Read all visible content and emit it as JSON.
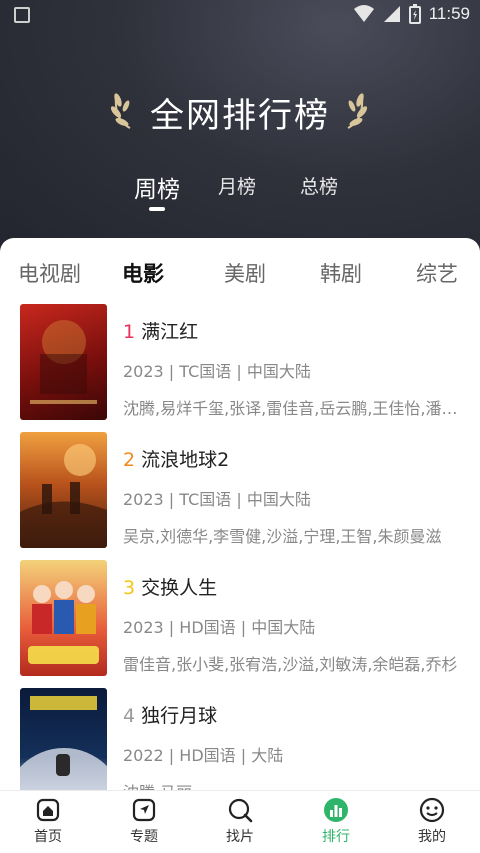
{
  "status_bar": {
    "time": "11:59"
  },
  "hero": {
    "title": "全网排行榜"
  },
  "rank_tabs": [
    {
      "label": "周榜",
      "active": true
    },
    {
      "label": "月榜",
      "active": false
    },
    {
      "label": "总榜",
      "active": false
    }
  ],
  "category_tabs": [
    {
      "label": "电视剧",
      "active": false
    },
    {
      "label": "电影",
      "active": true
    },
    {
      "label": "美剧",
      "active": false
    },
    {
      "label": "韩剧",
      "active": false
    },
    {
      "label": "综艺",
      "active": false
    }
  ],
  "movies": [
    {
      "rank": "1",
      "title": "满江红",
      "meta": "2023 | TC国语 | 中国大陆",
      "cast": "沈腾,易烊千玺,张译,雷佳音,岳云鹏,王佳怡,潘斌龙",
      "rank_color": "#e8305a"
    },
    {
      "rank": "2",
      "title": "流浪地球2",
      "meta": "2023 | TC国语 | 中国大陆",
      "cast": "吴京,刘德华,李雪健,沙溢,宁理,王智,朱颜曼滋",
      "rank_color": "#f08a1c"
    },
    {
      "rank": "3",
      "title": "交换人生",
      "meta": "2023 | HD国语 | 中国大陆",
      "cast": "雷佳音,张小斐,张宥浩,沙溢,刘敏涛,余皑磊,乔杉",
      "rank_color": "#f5c518"
    },
    {
      "rank": "4",
      "title": "独行月球",
      "meta": "2022 | HD国语 | 大陆",
      "cast": "沈腾,马丽",
      "rank_color": "#999999"
    }
  ],
  "bottom_nav": [
    {
      "label": "首页",
      "icon": "home-icon",
      "active": false
    },
    {
      "label": "专题",
      "icon": "topic-icon",
      "active": false
    },
    {
      "label": "找片",
      "icon": "search-icon",
      "active": false
    },
    {
      "label": "排行",
      "icon": "ranking-icon",
      "active": true
    },
    {
      "label": "我的",
      "icon": "profile-icon",
      "active": false
    }
  ],
  "colors": {
    "accent": "#2fb56a",
    "hero_bg": "#2f313b"
  }
}
